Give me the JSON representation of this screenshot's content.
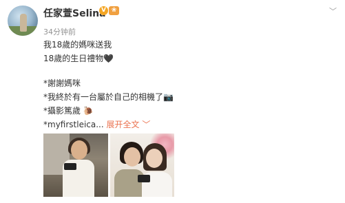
{
  "post": {
    "username": "任家萱Selina",
    "verified_badge": "V",
    "level_badge": "❀",
    "timestamp": "34分钟前",
    "lines": [
      "我18歲的媽咪送我",
      "18歲的生日禮物🖤",
      "*謝謝媽咪",
      "*我終於有一台屬於自己的相機了📷",
      "*攝影篤歲 🐌"
    ],
    "truncated_line": "*myfirstleica...",
    "expand_label": "展开全文",
    "expand_caret": "﹀",
    "more_icon": "﹀"
  },
  "images": [
    {
      "alt": "photo-1"
    },
    {
      "alt": "photo-2"
    }
  ]
}
